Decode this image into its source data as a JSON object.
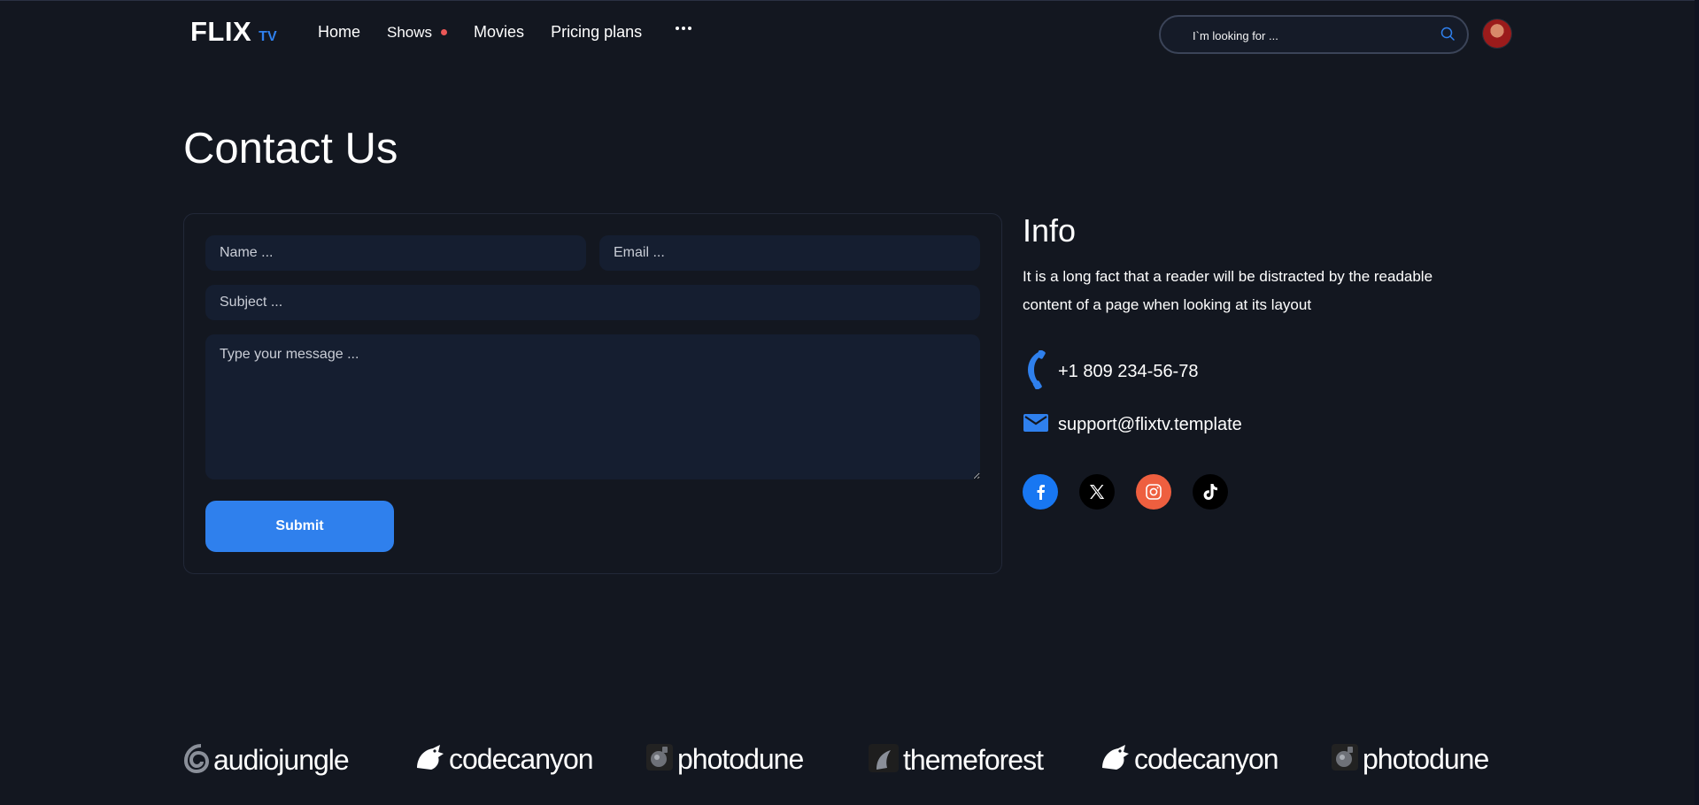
{
  "brand": {
    "name": "FLIX",
    "suffix": "TV",
    "accent": "#2f80ed"
  },
  "nav": {
    "items": [
      {
        "label": "Home"
      },
      {
        "label": "Shows",
        "live_dot_color": "#eb5757"
      },
      {
        "label": "Movies"
      },
      {
        "label": "Pricing plans"
      }
    ],
    "more_icon": "ellipsis-icon"
  },
  "search": {
    "placeholder": "I`m looking for ...",
    "icon": "search-icon"
  },
  "page": {
    "title": "Contact Us"
  },
  "form": {
    "name_placeholder": "Name ...",
    "email_placeholder": "Email ...",
    "subject_placeholder": "Subject ...",
    "message_placeholder": "Type your message ...",
    "submit_label": "Submit"
  },
  "info": {
    "title": "Info",
    "text": "It is a long fact that a reader will be distracted by the readable content of a page when looking at its layout",
    "phone": "+1 809 234-56-78",
    "email": "support@flixtv.template",
    "socials": [
      "facebook",
      "x-twitter",
      "instagram",
      "tiktok"
    ]
  },
  "partners": [
    {
      "name": "audiojungle",
      "icon": "audiojungle-icon"
    },
    {
      "name": "codecanyon",
      "icon": "codecanyon-icon"
    },
    {
      "name": "photodune",
      "icon": "photodune-icon"
    },
    {
      "name": "themeforest",
      "icon": "themeforest-icon"
    },
    {
      "name": "codecanyon",
      "icon": "codecanyon-icon"
    },
    {
      "name": "photodune",
      "icon": "photodune-icon"
    }
  ]
}
